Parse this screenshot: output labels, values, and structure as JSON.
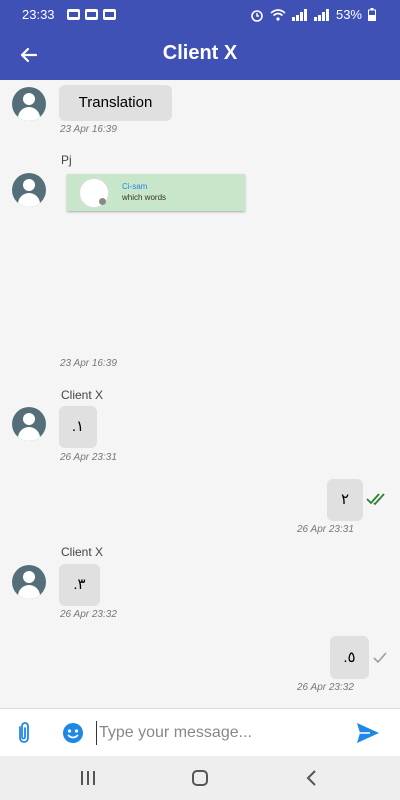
{
  "status": {
    "time": "23:33",
    "battery": "53%"
  },
  "header": {
    "title": "Client X"
  },
  "messages": [
    {
      "sender": "",
      "text": "Translation",
      "time": "23 Apr 16:39"
    },
    {
      "sender": "Pj",
      "card_name": "Ci-sam",
      "card_sub": "which words",
      "time": "23 Apr 16:39"
    },
    {
      "sender": "Client X",
      "text": ".١",
      "time": "26 Apr 23:31"
    },
    {
      "sender": "",
      "text": "٢",
      "time": "26 Apr 23:31",
      "status": "read"
    },
    {
      "sender": "Client X",
      "text": ".٣",
      "time": "26 Apr 23:32"
    },
    {
      "sender": "",
      "text": ".٥",
      "time": "26 Apr 23:32",
      "status": "sent"
    }
  ],
  "composer": {
    "placeholder": "Type your message..."
  },
  "colors": {
    "primary": "#3f51b5",
    "read_check": "#2e7d32",
    "sent_check": "#9e9e9e",
    "send": "#1e88e5",
    "card_bg": "#c8e6c9",
    "card_name": "#1e88e5"
  },
  "icons": [
    "back-arrow-icon",
    "avatar-icon",
    "double-check-icon",
    "check-icon",
    "attach-icon",
    "emoji-icon",
    "send-icon",
    "nav-recents-icon",
    "nav-home-icon",
    "nav-back-icon"
  ]
}
